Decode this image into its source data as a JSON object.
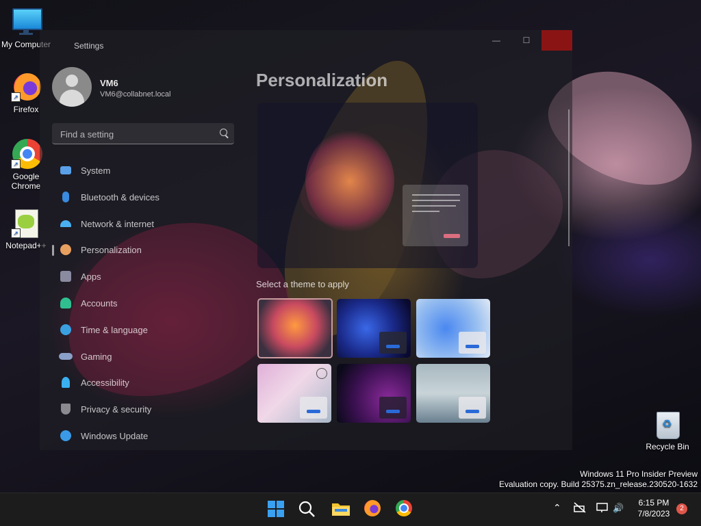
{
  "desktop_icons": [
    {
      "label": "My Computer",
      "icon": "monitor-icon"
    },
    {
      "label": "Firefox",
      "icon": "firefox-icon"
    },
    {
      "label": "Google Chrome",
      "icon": "chrome-icon"
    },
    {
      "label": "Notepad++",
      "icon": "notepad-plus-plus-icon"
    },
    {
      "label": "Recycle Bin",
      "icon": "recycle-bin-icon"
    }
  ],
  "window": {
    "title": "Settings",
    "minimize_glyph": "—",
    "maximize_glyph": "☐",
    "close_glyph": "✕"
  },
  "user": {
    "name": "VM6",
    "email": "VM6@collabnet.local"
  },
  "search": {
    "placeholder": "Find a setting"
  },
  "nav": [
    {
      "label": "System",
      "icon": "system-icon",
      "color": "#5aa0e8"
    },
    {
      "label": "Bluetooth & devices",
      "icon": "bluetooth-icon",
      "color": "#3a8ae0"
    },
    {
      "label": "Network & internet",
      "icon": "network-icon",
      "color": "#4ab0f0"
    },
    {
      "label": "Personalization",
      "icon": "personalization-icon",
      "color": "#e8a060"
    },
    {
      "label": "Apps",
      "icon": "apps-icon",
      "color": "#8a8aa0"
    },
    {
      "label": "Accounts",
      "icon": "accounts-icon",
      "color": "#30c090"
    },
    {
      "label": "Time & language",
      "icon": "time-language-icon",
      "color": "#3aa0e0"
    },
    {
      "label": "Gaming",
      "icon": "gaming-icon",
      "color": "#8aa0c8"
    },
    {
      "label": "Accessibility",
      "icon": "accessibility-icon",
      "color": "#3ab0f0"
    },
    {
      "label": "Privacy & security",
      "icon": "shield-icon",
      "color": "#8a8a90"
    },
    {
      "label": "Windows Update",
      "icon": "windows-update-icon",
      "color": "#3a9ae8"
    }
  ],
  "main": {
    "title": "Personalization",
    "theme_section_label": "Select a theme to apply"
  },
  "watermark": {
    "line1": "Windows 11 Pro Insider Preview",
    "line2": "Evaluation copy. Build 25375.zn_release.230520-1632"
  },
  "taskbar": {
    "time": "6:15 PM",
    "date": "7/8/2023",
    "notification_count": "2",
    "tray_chevron": "⌃",
    "speaker_glyph": "🔊"
  }
}
